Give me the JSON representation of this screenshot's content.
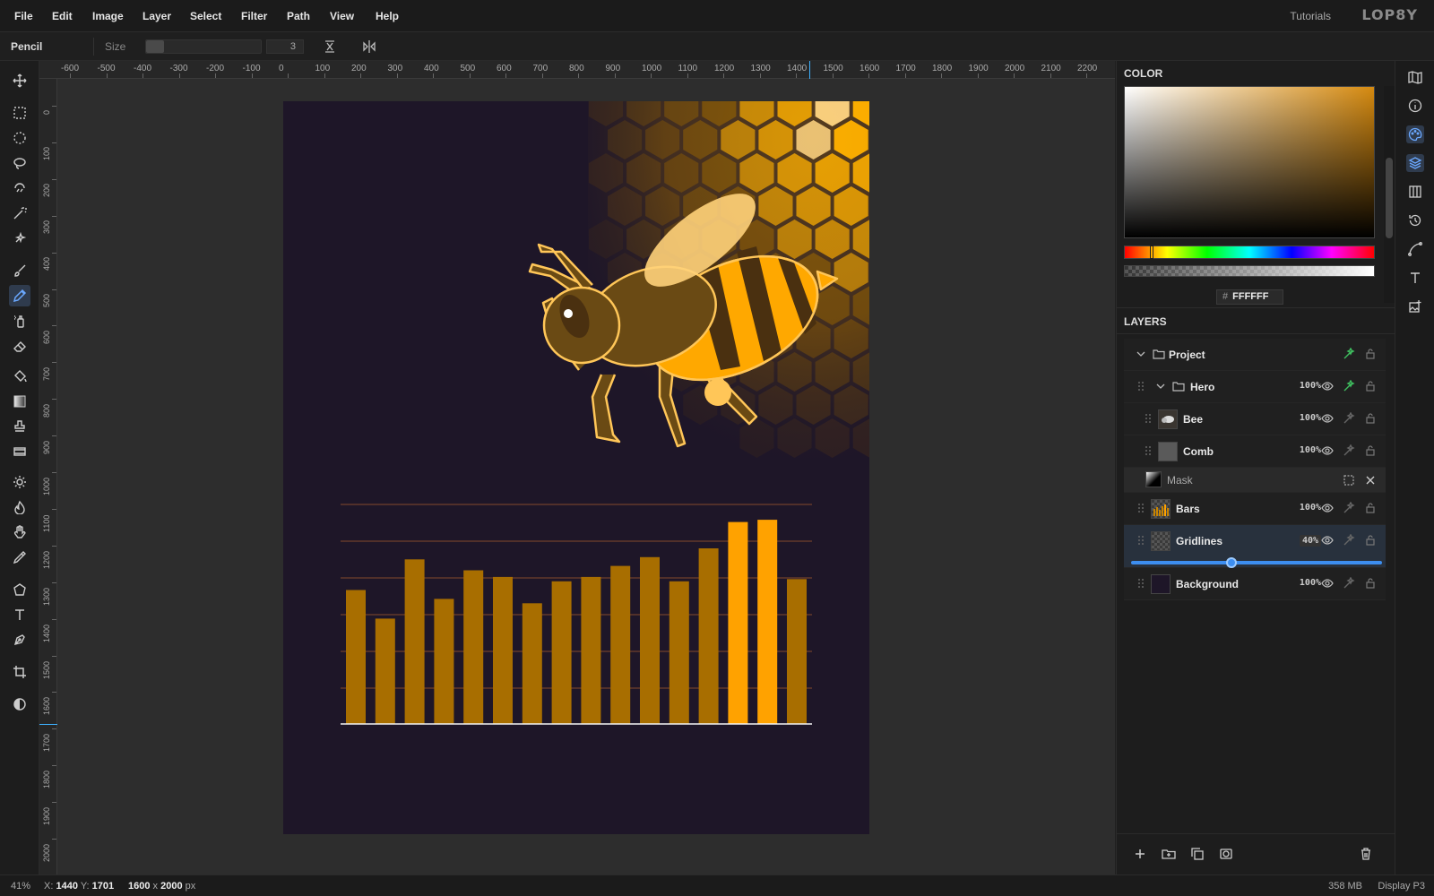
{
  "menubar": {
    "items": [
      "File",
      "Edit",
      "Image",
      "Layer",
      "Select",
      "Filter",
      "Path",
      "View",
      "Help"
    ],
    "tutorials": "Tutorials",
    "logo": "LOP8Y"
  },
  "options": {
    "tool_name": "Pencil",
    "size_label": "Size",
    "size_value": "3"
  },
  "toolbar": {
    "tools": [
      "move-icon",
      "rect-select-icon",
      "ellipse-select-icon",
      "lasso-icon",
      "magnetic-lasso-icon",
      "magic-wand-icon",
      "quick-select-icon",
      "brush-icon",
      "pencil-icon",
      "spray-icon",
      "eraser-icon",
      "bucket-icon",
      "gradient-icon",
      "stamp-icon",
      "filmstrip-icon",
      "dodge-icon",
      "burn-icon",
      "hand-icon",
      "eyedropper-icon",
      "polygon-icon",
      "text-icon",
      "pen-icon",
      "crop-icon",
      "contrast-icon"
    ],
    "active": "pencil-icon"
  },
  "rulers": {
    "top_labels": [
      "-600",
      "-500",
      "-400",
      "-300",
      "-200",
      "-100",
      "0",
      "100",
      "200",
      "300",
      "400",
      "500",
      "600",
      "700",
      "800",
      "900",
      "1000",
      "1100",
      "1200",
      "1300",
      "1400",
      "1500",
      "1600",
      "1700",
      "1800",
      "1900",
      "2000",
      "2100",
      "2200"
    ],
    "left_labels": [
      "0",
      "100",
      "200",
      "300",
      "400",
      "500",
      "600",
      "700",
      "800",
      "900",
      "1000",
      "1100",
      "1200",
      "1300",
      "1400",
      "1500",
      "1600",
      "1700",
      "1800",
      "1900",
      "2000"
    ]
  },
  "artwork": {
    "bar_values": [
      0.61,
      0.48,
      0.75,
      0.57,
      0.7,
      0.67,
      0.55,
      0.65,
      0.67,
      0.72,
      0.76,
      0.65,
      0.8,
      0.92,
      0.93,
      0.66
    ],
    "highlight_bars": [
      13,
      14
    ],
    "colors": {
      "background": "#1e1628",
      "bar": "#a86e00",
      "bar_highlight": "#ffa200",
      "honey": "#ffb000",
      "honey_dark": "#8a5a00"
    }
  },
  "color_panel": {
    "title": "COLOR",
    "hex_hash": "#",
    "hex": "FFFFFF"
  },
  "layers_panel": {
    "title": "LAYERS",
    "rows": [
      {
        "name": "Project"
      },
      {
        "name": "Hero",
        "opacity": "100%"
      },
      {
        "name": "Bee",
        "opacity": "100%"
      },
      {
        "name": "Comb",
        "opacity": "100%"
      },
      {
        "name": "Mask"
      },
      {
        "name": "Bars",
        "opacity": "100%"
      },
      {
        "name": "Gridlines",
        "opacity": "40%",
        "slider_value": 0.4
      },
      {
        "name": "Background",
        "opacity": "100%"
      }
    ]
  },
  "right_strip": [
    "map-icon",
    "info-icon",
    "palette-icon",
    "layers-icon",
    "columns-icon",
    "history-icon",
    "path-icon",
    "type-icon",
    "image-add-icon"
  ],
  "status": {
    "zoom": "41%",
    "x_label": "X:",
    "x_value": "1440",
    "y_label": "Y:",
    "y_value": "1701",
    "doc_w": "1600",
    "doc_x": "x",
    "doc_h": "2000",
    "doc_unit": "px",
    "memory": "358 MB",
    "profile": "Display P3"
  }
}
